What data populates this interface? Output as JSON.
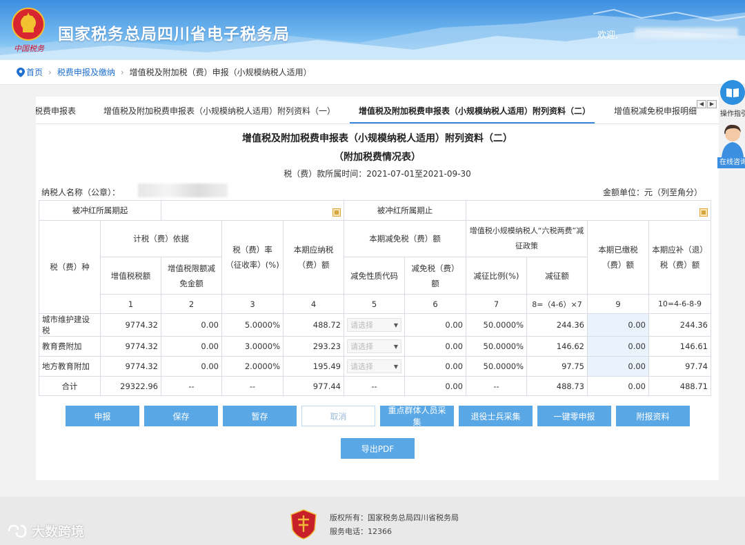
{
  "header": {
    "site_title": "国家税务总局四川省电子税务局",
    "brand_sub": "中国税务",
    "welcome": "欢迎,"
  },
  "breadcrumb": {
    "home": "首页",
    "level1": "税费申报及缴纳",
    "current": "增值税及附加税（费）申报（小规模纳税人适用）"
  },
  "tabs": [
    "税费申报表",
    "增值税及附加税费申报表（小规模纳税人适用）附列资料（一）",
    "增值税及附加税费申报表（小规模纳税人适用）附列资料（二）",
    "增值税减免税申报明细"
  ],
  "form": {
    "title": "增值税及附加税费申报表（小规模纳税人适用）附列资料（二）",
    "subtitle": "（附加税费情况表）",
    "period": "税（费）款所属时间：2021-07-01至2021-09-30",
    "taxpayer_label": "纳税人名称（公章）：",
    "unit": "金额单位：元（列至角分）"
  },
  "table": {
    "offset_start": "被冲红所属期起",
    "offset_end": "被冲红所属期止",
    "h_tax_type": "税（费）种",
    "h_basis": "计税（费）依据",
    "h_rate": "税（费）率（征收率）(%)",
    "h_payable": "本期应纳税（费）额",
    "h_reduction": "本期减免税（费）额",
    "h_policy": "增值税小规模纳税人“六税两费”减征政策",
    "h_paid": "本期已缴税（费）额",
    "h_refund": "本期应补（退）税（费）额",
    "h_vat": "增值税税额",
    "h_vat_deduct": "增值税限额减免金额",
    "h_code": "减免性质代码",
    "h_reduce_amt": "减免税（费）额",
    "h_ratio": "减征比例(%)",
    "h_reduce_val": "减征额",
    "colnums": [
      "1",
      "2",
      "3",
      "4",
      "5",
      "6",
      "7",
      "8=（4-6）×7",
      "9",
      "10=4-6-8-9"
    ],
    "select_placeholder": "请选择",
    "rows": [
      {
        "name": "城市维护建设税",
        "c1": "9774.32",
        "c2": "0.00",
        "c3": "5.0000%",
        "c4": "488.72",
        "c6": "0.00",
        "c7": "50.0000%",
        "c8": "244.36",
        "c9": "0.00",
        "c10": "244.36"
      },
      {
        "name": "教育费附加",
        "c1": "9774.32",
        "c2": "0.00",
        "c3": "3.0000%",
        "c4": "293.23",
        "c6": "0.00",
        "c7": "50.0000%",
        "c8": "146.62",
        "c9": "0.00",
        "c10": "146.61"
      },
      {
        "name": "地方教育附加",
        "c1": "9774.32",
        "c2": "0.00",
        "c3": "2.0000%",
        "c4": "195.49",
        "c6": "0.00",
        "c7": "50.0000%",
        "c8": "97.75",
        "c9": "0.00",
        "c10": "97.74"
      }
    ],
    "total": {
      "name": "合计",
      "c1": "29322.96",
      "c2": "--",
      "c3": "--",
      "c4": "977.44",
      "c5": "--",
      "c6": "0.00",
      "c7": "--",
      "c8": "488.73",
      "c9": "0.00",
      "c10": "488.71"
    }
  },
  "buttons": {
    "declare": "申报",
    "save": "保存",
    "temp_save": "暂存",
    "cancel": "取消",
    "key_group": "重点群体人员采集",
    "veteran": "退役士兵采集",
    "zero": "一键零申报",
    "attach": "附报资料",
    "export_pdf": "导出PDF"
  },
  "side": {
    "guide": "操作指引",
    "consult": "在线咨询"
  },
  "footer": {
    "copyright": "版权所有：国家税务总局四川省税务局",
    "phone": "服务电话：12366"
  },
  "watermark": "大数跨境",
  "colors": {
    "header_blue": "#3d8ee0",
    "button_blue": "#5aa7e6",
    "link_blue": "#1e6fd0"
  }
}
